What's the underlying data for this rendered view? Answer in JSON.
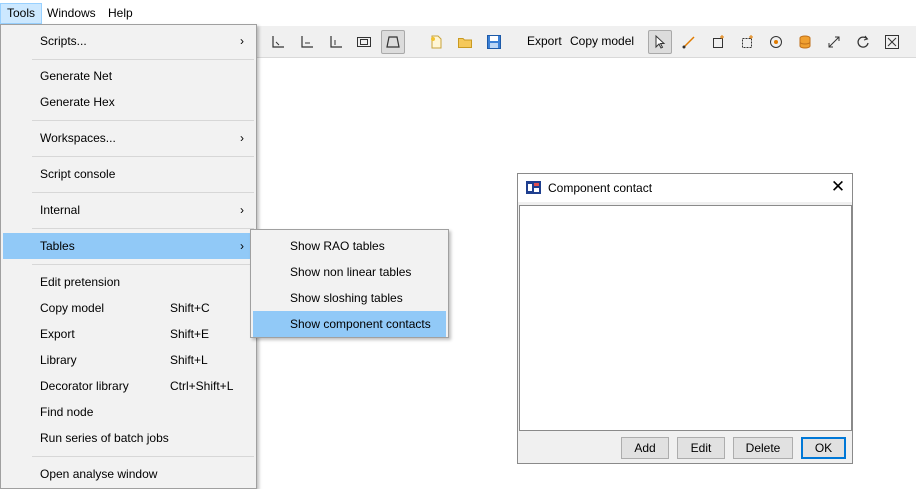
{
  "menubar": {
    "items": [
      {
        "label": "Tools"
      },
      {
        "label": "Windows"
      },
      {
        "label": "Help"
      }
    ]
  },
  "tools_menu": {
    "items": [
      {
        "label": "Scripts...",
        "submenu_arrow": "›"
      },
      {
        "label": "Generate Net"
      },
      {
        "label": "Generate Hex"
      },
      {
        "label": "Workspaces...",
        "submenu_arrow": "›"
      },
      {
        "label": "Script console"
      },
      {
        "label": "Internal",
        "submenu_arrow": "›"
      },
      {
        "label": "Tables",
        "submenu_arrow": "›",
        "highlighted": true
      },
      {
        "label": "Edit pretension"
      },
      {
        "label": "Copy model",
        "shortcut": "Shift+C"
      },
      {
        "label": "Export",
        "shortcut": "Shift+E"
      },
      {
        "label": "Library",
        "shortcut": "Shift+L"
      },
      {
        "label": "Decorator library",
        "shortcut": "Ctrl+Shift+L"
      },
      {
        "label": "Find node"
      },
      {
        "label": "Run series of batch jobs"
      },
      {
        "label": "Open analyse window"
      }
    ]
  },
  "tables_submenu": {
    "items": [
      {
        "label": "Show RAO tables"
      },
      {
        "label": "Show non linear tables"
      },
      {
        "label": "Show sloshing tables"
      },
      {
        "label": "Show component contacts",
        "highlighted": true
      }
    ]
  },
  "toolbar": {
    "export_label": "Export",
    "copy_model_label": "Copy model",
    "icons": [
      "axis-icon",
      "axis-icon",
      "axis-icon",
      "frame-icon",
      "fit-icon",
      "new-file-icon",
      "open-folder-icon",
      "save-icon",
      "pointer-icon",
      "line-icon",
      "rectangle-icon",
      "grid-rectangle-icon",
      "target-icon",
      "database-icon",
      "resize-icon",
      "rotate-icon",
      "zoom-fit-icon"
    ]
  },
  "dialog": {
    "title": "Component contact",
    "add_label": "Add",
    "edit_label": "Edit",
    "delete_label": "Delete",
    "ok_label": "OK"
  },
  "colors": {
    "menu_highlight": "#91c9f7",
    "menubar_active": "#cce8ff",
    "default_button_border": "#0078d7"
  }
}
